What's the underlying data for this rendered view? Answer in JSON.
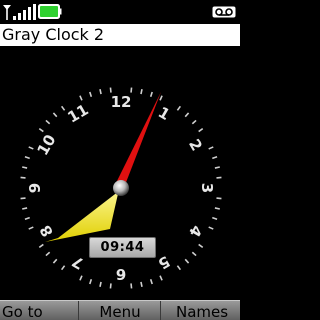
{
  "app": {
    "title": "Gray Clock 2"
  },
  "status_bar": {
    "signal_icon": "signal-strength-icon",
    "battery_icon": "battery-icon",
    "voicemail_icon": "voicemail-icon",
    "battery_color": "#2fd12f"
  },
  "clock": {
    "dial_numbers": [
      "12",
      "1",
      "2",
      "3",
      "4",
      "5",
      "6",
      "7",
      "8",
      "9",
      "10",
      "11"
    ],
    "digital_time": "09:44",
    "hour_hand_color": "#f2e600",
    "minute_hand_color": "#e01010"
  },
  "softkeys": {
    "left": "Go to",
    "middle": "Menu",
    "right": "Names"
  }
}
